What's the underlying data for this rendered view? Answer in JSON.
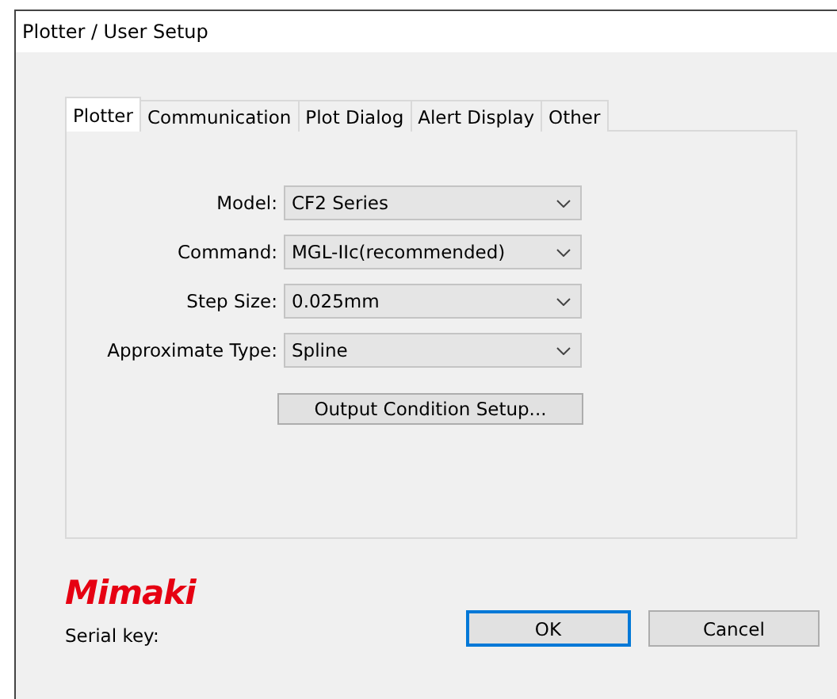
{
  "window": {
    "title": "Plotter / User Setup"
  },
  "tabs": [
    {
      "label": "Plotter",
      "selected": true
    },
    {
      "label": "Communication",
      "selected": false
    },
    {
      "label": "Plot Dialog",
      "selected": false
    },
    {
      "label": "Alert Display",
      "selected": false
    },
    {
      "label": "Other",
      "selected": false
    }
  ],
  "fields": [
    {
      "label": "Model:",
      "value": "CF2 Series"
    },
    {
      "label": "Command:",
      "value": "MGL-IIc(recommended)"
    },
    {
      "label": "Step Size:",
      "value": "0.025mm"
    },
    {
      "label": "Approximate Type:",
      "value": "Spline"
    }
  ],
  "setup_button": "Output Condition Setup...",
  "logo": "Mimaki",
  "serial_key_label": "Serial key:",
  "buttons": [
    {
      "label": "OK",
      "default": true
    },
    {
      "label": "Cancel",
      "default": false
    }
  ]
}
